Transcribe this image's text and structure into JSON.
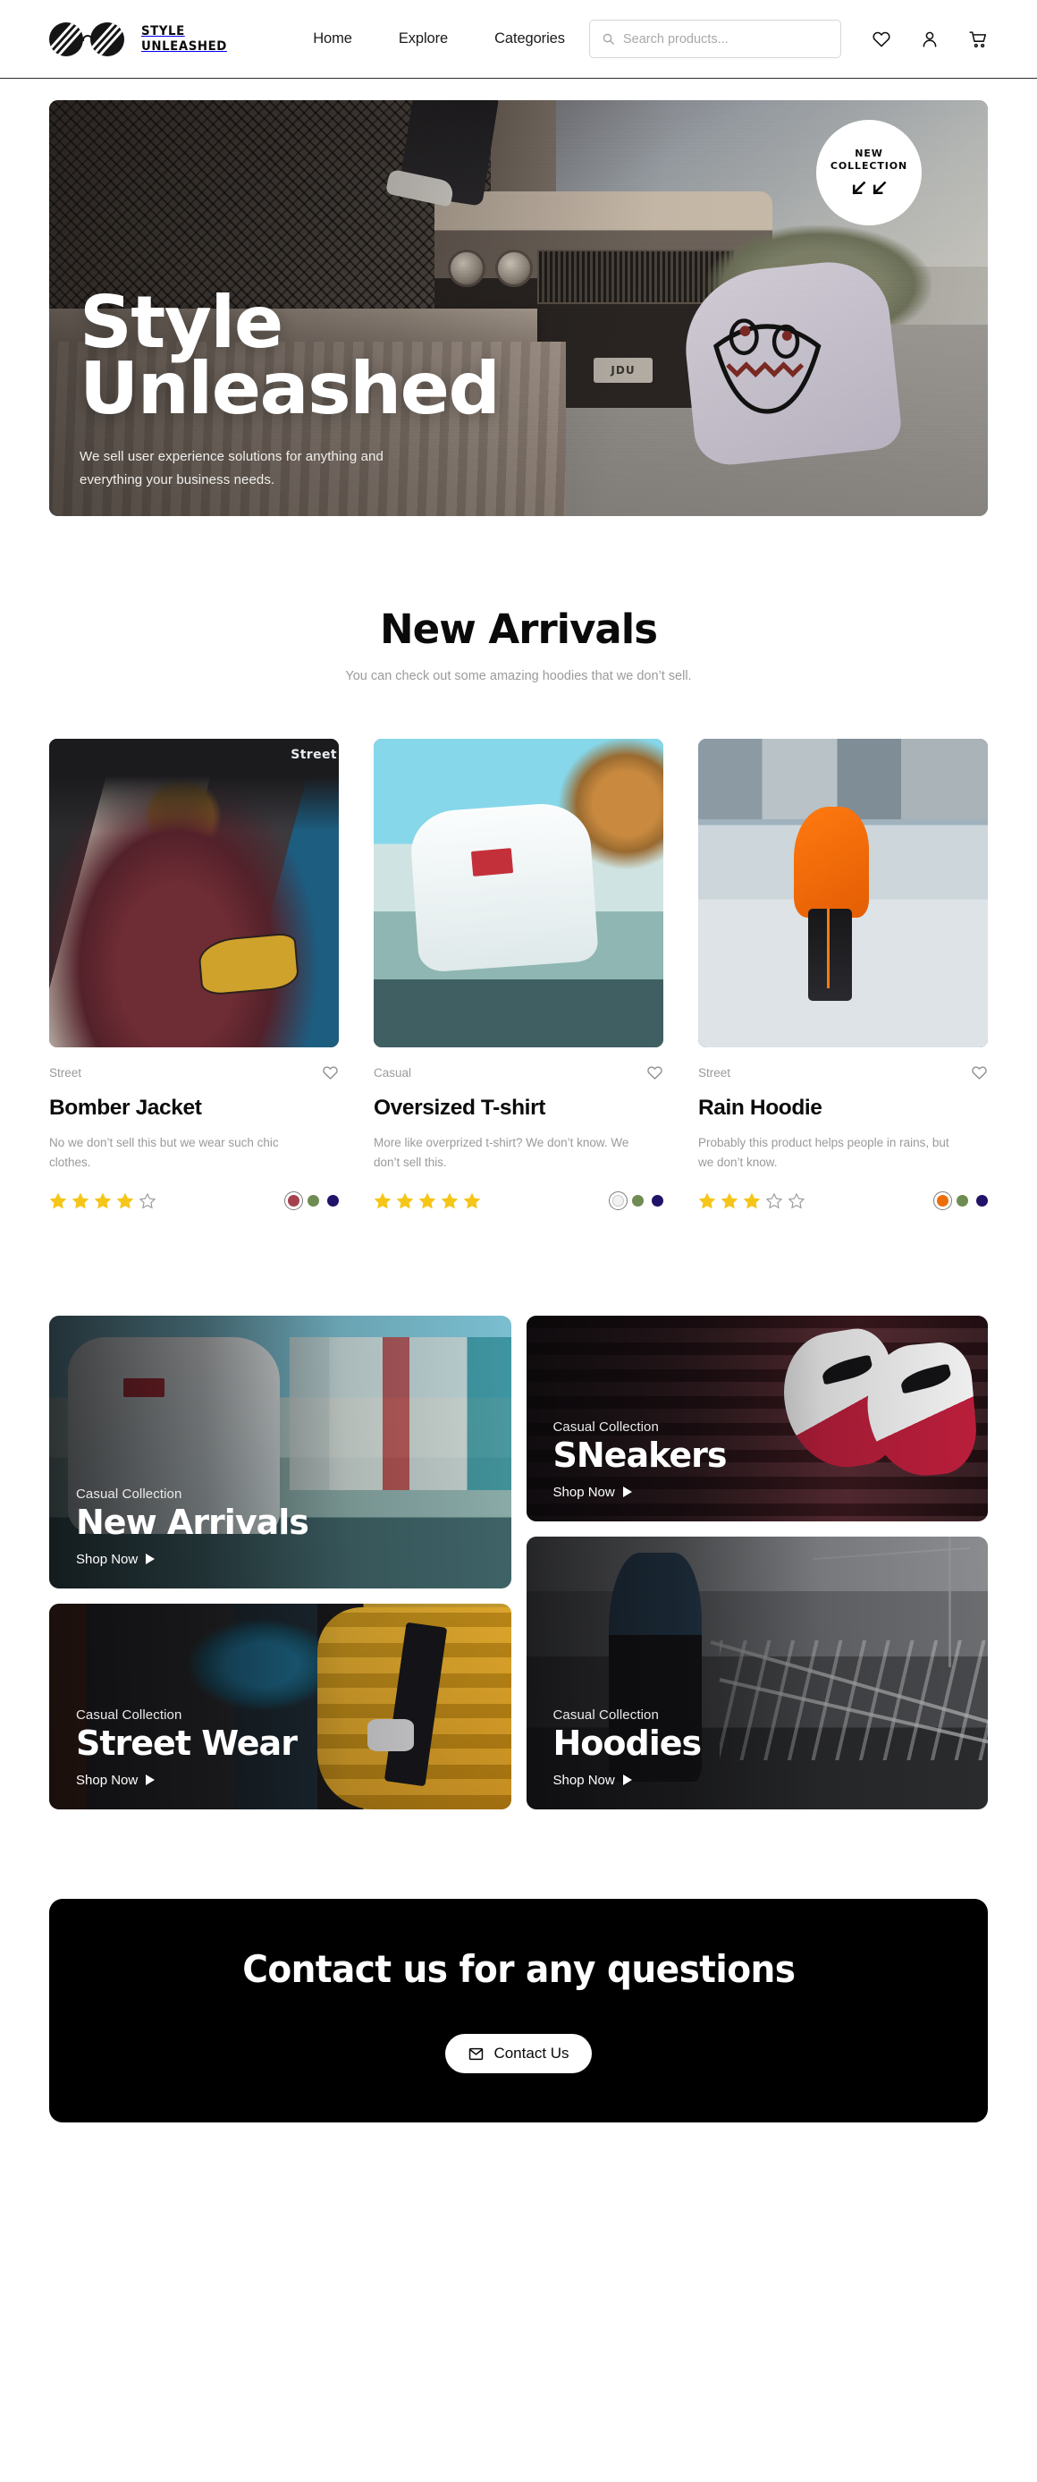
{
  "header": {
    "brand_line1": "Style",
    "brand_line2": "Unleashed",
    "nav": [
      {
        "label": "Home"
      },
      {
        "label": "Explore"
      },
      {
        "label": "Categories"
      }
    ],
    "search": {
      "placeholder": "Search products...",
      "value": "",
      "icon": "search-icon"
    },
    "icons": [
      {
        "name": "heart-icon",
        "label": "Wishlist"
      },
      {
        "name": "user-icon",
        "label": "Account"
      },
      {
        "name": "cart-icon",
        "label": "Cart"
      }
    ]
  },
  "hero": {
    "title_line1": "Style",
    "title_line2": "Unleashed",
    "subtitle": "We sell user experience solutions for anything and everything your business needs.",
    "badge_line1": "NEW",
    "badge_line2": "COLLECTION",
    "badge_arrows_icon": "arrow-down-left-icon",
    "plate_text": "JDU"
  },
  "arrivals": {
    "title": "New Arrivals",
    "subtitle": "You can check out some amazing hoodies that we don’t sell.",
    "products": [
      {
        "category": "Street",
        "name": "Bomber Jacket",
        "description": "No we don’t sell this but we wear such chic clothes.",
        "rating": 4,
        "max_rating": 5,
        "wishlist_icon": "heart-icon",
        "image_label": "Street",
        "colors": [
          {
            "hex": "#a6414f",
            "selected": true
          },
          {
            "hex": "#6f8c52",
            "selected": false
          },
          {
            "hex": "#231269",
            "selected": false
          }
        ]
      },
      {
        "category": "Casual",
        "name": "Oversized T-shirt",
        "description": "More like overprized t-shirt? We don’t know. We don’t sell this.",
        "rating": 5,
        "max_rating": 5,
        "wishlist_icon": "heart-icon",
        "colors": [
          {
            "hex": "#f2f2f2",
            "selected": true
          },
          {
            "hex": "#6f8c52",
            "selected": false
          },
          {
            "hex": "#231269",
            "selected": false
          }
        ]
      },
      {
        "category": "Street",
        "name": "Rain Hoodie",
        "description": "Probably this product helps people in rains, but we don’t know.",
        "rating": 3,
        "max_rating": 5,
        "wishlist_icon": "heart-icon",
        "colors": [
          {
            "hex": "#ec6d0a",
            "selected": true
          },
          {
            "hex": "#6f8c52",
            "selected": false
          },
          {
            "hex": "#231269",
            "selected": false
          }
        ]
      }
    ]
  },
  "collections": [
    {
      "kicker": "Casual Collection",
      "title": "New Arrivals",
      "cta": "Shop Now",
      "cta_icon": "play-triangle-icon"
    },
    {
      "kicker": "Casual Collection",
      "title": "SNeakers",
      "cta": "Shop Now",
      "cta_icon": "play-triangle-icon"
    },
    {
      "kicker": "Casual Collection",
      "title": "Street Wear",
      "cta": "Shop Now",
      "cta_icon": "play-triangle-icon"
    },
    {
      "kicker": "Casual Collection",
      "title": "Hoodies",
      "cta": "Shop Now",
      "cta_icon": "play-triangle-icon"
    }
  ],
  "contact": {
    "title": "Contact us for any questions",
    "button_label": "Contact Us",
    "button_icon": "mail-icon"
  },
  "colors": {
    "ink": "#0a0a0a",
    "muted": "#9a9a9a",
    "star_filled": "#f5c518",
    "star_empty": "#9a9a9a",
    "contact_bg": "#000000"
  }
}
